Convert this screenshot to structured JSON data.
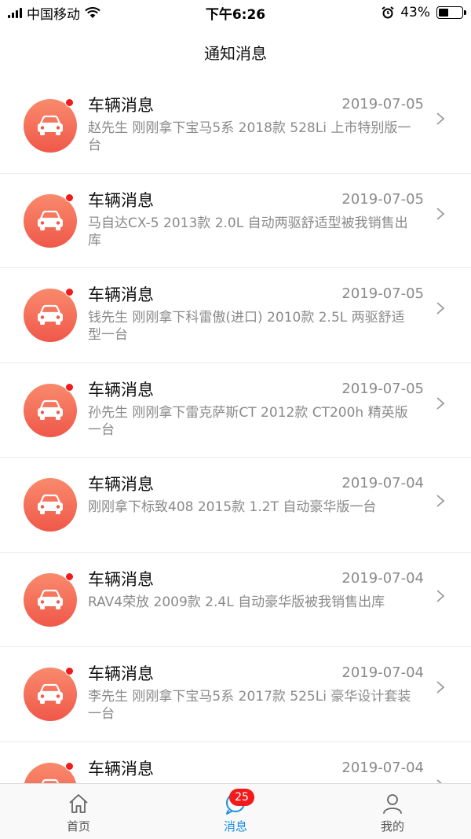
{
  "status_bar": {
    "carrier": "中国移动",
    "time": "下午6:26",
    "battery": "43%",
    "battery_level": 0.43
  },
  "header": {
    "title": "通知消息"
  },
  "messages": [
    {
      "title": "车辆消息",
      "date": "2019-07-05",
      "body": "赵先生 刚刚拿下宝马5系 2018款 528Li 上市特别版一台",
      "unread": true
    },
    {
      "title": "车辆消息",
      "date": "2019-07-05",
      "body": "马自达CX-5 2013款 2.0L 自动两驱舒适型被我销售出库",
      "unread": true
    },
    {
      "title": "车辆消息",
      "date": "2019-07-05",
      "body": "钱先生 刚刚拿下科雷傲(进口) 2010款 2.5L 两驱舒适型一台",
      "unread": true
    },
    {
      "title": "车辆消息",
      "date": "2019-07-05",
      "body": "孙先生 刚刚拿下雷克萨斯CT 2012款 CT200h 精英版一台",
      "unread": true
    },
    {
      "title": "车辆消息",
      "date": "2019-07-04",
      "body": " 刚刚拿下标致408 2015款 1.2T 自动豪华版一台",
      "unread": false
    },
    {
      "title": "车辆消息",
      "date": "2019-07-04",
      "body": "RAV4荣放 2009款 2.4L 自动豪华版被我销售出库",
      "unread": true
    },
    {
      "title": "车辆消息",
      "date": "2019-07-04",
      "body": "李先生 刚刚拿下宝马5系 2017款 525Li 豪华设计套装一台",
      "unread": true
    },
    {
      "title": "车辆消息",
      "date": "2019-07-04",
      "body": "",
      "unread": true
    }
  ],
  "tab_bar": {
    "home_label": "首页",
    "messages_label": "消息",
    "messages_badge": "25",
    "profile_label": "我的"
  },
  "colors": {
    "accent": "#1a8fe0",
    "avatar_gradient_top": "#f98a6c",
    "avatar_gradient_bottom": "#f0584a",
    "unread_dot": "#f21a1a"
  },
  "icons": {
    "avatar": "car-icon",
    "row_arrow": "chevron-right-icon",
    "home": "home-icon",
    "messages": "chat-bubble-icon",
    "profile": "person-icon"
  }
}
